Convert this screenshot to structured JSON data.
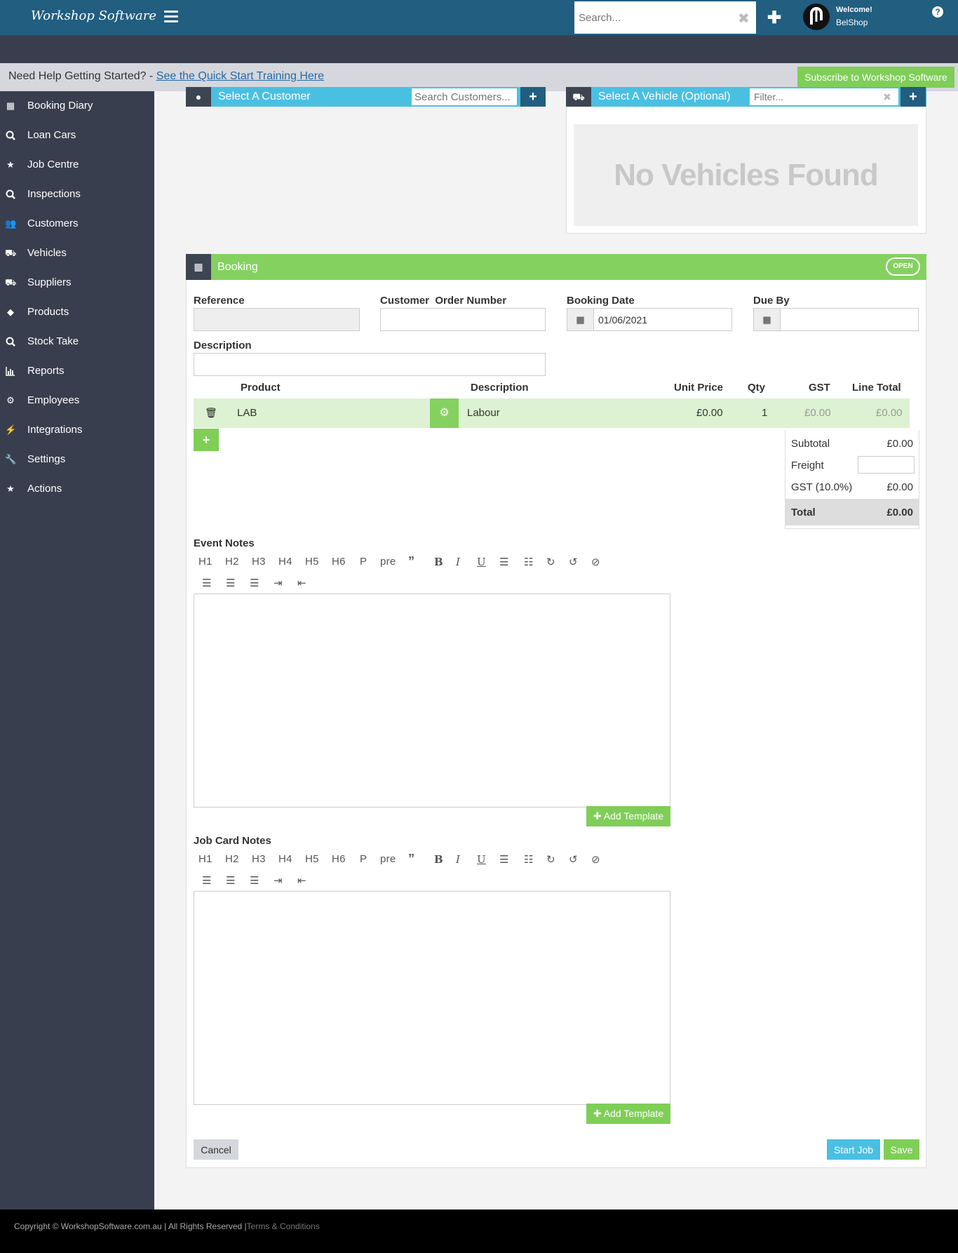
{
  "topbar": {
    "brand": "Workshop Software",
    "search_placeholder": "Search...",
    "welcome": "Welcome!",
    "user": "BelShop"
  },
  "helpbar": {
    "question": "Need Help Getting Started? - ",
    "link": "See the Quick Start Training Here",
    "subscribe": "Subscribe to Workshop Software"
  },
  "sidebar": {
    "items": [
      {
        "label": "Booking Diary",
        "icon": "calendar-icon"
      },
      {
        "label": "Loan Cars",
        "icon": "search-icon"
      },
      {
        "label": "Job Centre",
        "icon": "star-icon"
      },
      {
        "label": "Inspections",
        "icon": "search-icon"
      },
      {
        "label": "Customers",
        "icon": "users-icon"
      },
      {
        "label": "Vehicles",
        "icon": "car-icon"
      },
      {
        "label": "Suppliers",
        "icon": "truck-icon"
      },
      {
        "label": "Products",
        "icon": "tags-icon"
      },
      {
        "label": "Stock Take",
        "icon": "search-icon"
      },
      {
        "label": "Reports",
        "icon": "bar-chart-icon"
      },
      {
        "label": "Employees",
        "icon": "cogs-icon"
      },
      {
        "label": "Integrations",
        "icon": "plug-icon"
      },
      {
        "label": "Settings",
        "icon": "wrench-icon"
      },
      {
        "label": "Actions",
        "icon": "star-icon"
      }
    ]
  },
  "customer": {
    "title": "Select A Customer",
    "search_placeholder": "Search Customers..."
  },
  "vehicle": {
    "title": "Select A Vehicle (Optional)",
    "filter_placeholder": "Filter...",
    "empty": "No Vehicles Found"
  },
  "booking": {
    "title": "Booking",
    "status": "OPEN",
    "reference_label": "Reference",
    "order_label": "Customer  Order Number",
    "date_label": "Booking Date",
    "date_value": "01/06/2021",
    "due_label": "Due By",
    "description_label": "Description",
    "columns": {
      "product": "Product",
      "description": "Description",
      "unit_price": "Unit Price",
      "qty": "Qty",
      "gst": "GST",
      "line_total": "Line Total"
    },
    "line": {
      "product": "LAB",
      "description": "Labour",
      "unit_price": "£0.00",
      "qty": "1",
      "gst": "£0.00",
      "line_total": "£0.00"
    },
    "totals": {
      "subtotal_label": "Subtotal",
      "subtotal": "£0.00",
      "freight_label": "Freight",
      "gst_label": "GST (10.0%)",
      "gst": "£0.00",
      "total_label": "Total",
      "total": "£0.00"
    },
    "event_notes_label": "Event Notes",
    "job_card_notes_label": "Job Card Notes",
    "toolbar": [
      "H1",
      "H2",
      "H3",
      "H4",
      "H5",
      "H6",
      "P",
      "pre"
    ],
    "add_template": "Add Template",
    "cancel": "Cancel",
    "start_job": "Start Job",
    "save": "Save"
  },
  "footer": {
    "text": "Copyright © WorkshopSoftware.com.au | All Rights Reserved |",
    "terms": "Terms & Conditions"
  },
  "colors": {
    "topbar": "#215e80",
    "sidebar": "#393e4e",
    "customer_header": "#49c0e2",
    "booking_header": "#84d160",
    "accent_green": "#7fce57",
    "row_highlight": "#dcf2d2"
  }
}
